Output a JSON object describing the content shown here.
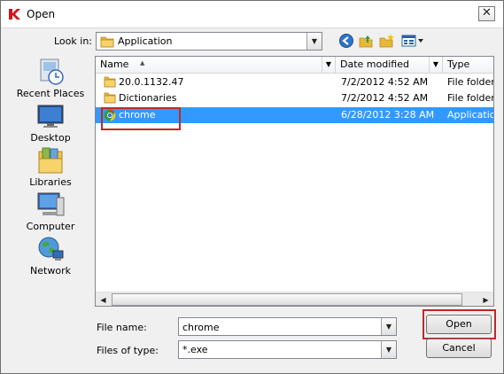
{
  "window": {
    "title": "Open"
  },
  "lookin": {
    "label": "Look in:",
    "value": "Application"
  },
  "places": [
    {
      "label": "Recent Places",
      "icon": "recent-places-icon"
    },
    {
      "label": "Desktop",
      "icon": "desktop-icon"
    },
    {
      "label": "Libraries",
      "icon": "libraries-icon"
    },
    {
      "label": "Computer",
      "icon": "computer-icon"
    },
    {
      "label": "Network",
      "icon": "network-icon"
    }
  ],
  "columns": {
    "name": "Name",
    "date": "Date modified",
    "type": "Type"
  },
  "files": [
    {
      "name": "20.0.1132.47",
      "date": "7/2/2012 4:52 AM",
      "type": "File folder",
      "icon": "folder-icon"
    },
    {
      "name": "Dictionaries",
      "date": "7/2/2012 4:52 AM",
      "type": "File folder",
      "icon": "folder-icon"
    },
    {
      "name": "chrome",
      "date": "6/28/2012 3:28 AM",
      "type": "Application",
      "icon": "chrome-icon",
      "selected": true
    }
  ],
  "filename": {
    "label": "File name:",
    "value": "chrome"
  },
  "filetype": {
    "label": "Files of type:",
    "value": "*.exe"
  },
  "buttons": {
    "open": "Open",
    "cancel": "Cancel"
  },
  "colors": {
    "selection": "#3399ff",
    "highlight_annotation": "#c0282a"
  }
}
